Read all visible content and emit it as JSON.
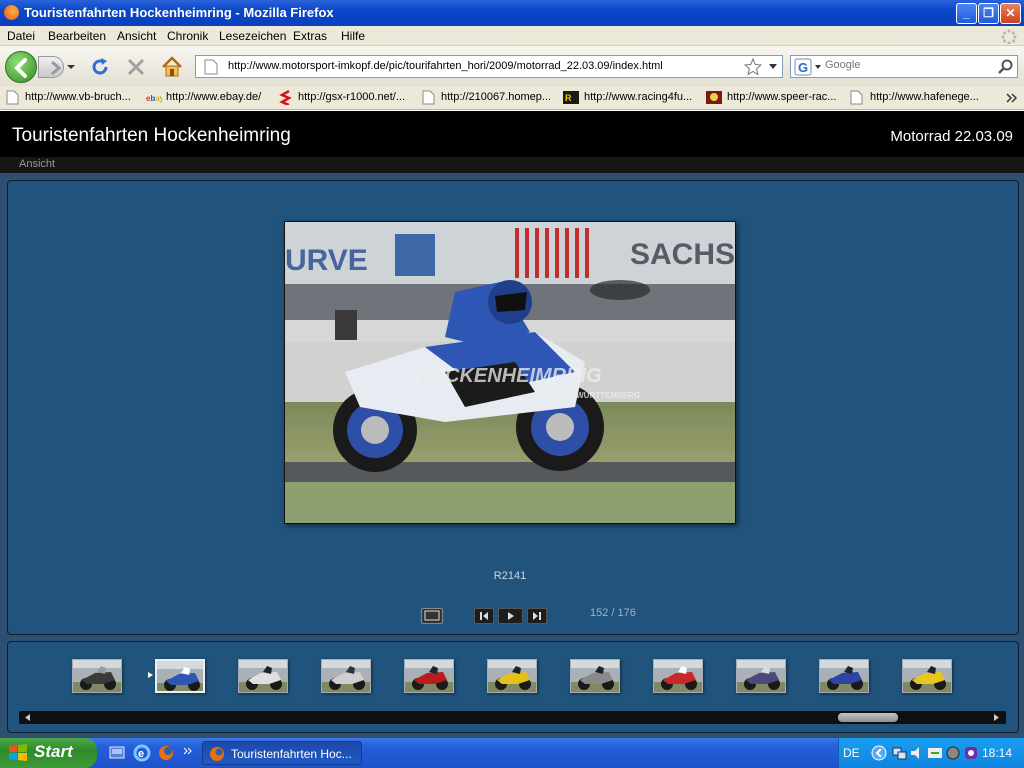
{
  "window": {
    "title": "Touristenfahrten Hockenheimring - Mozilla Firefox",
    "minimize_label": "_",
    "restore_label": "❐",
    "close_label": "✕"
  },
  "menubar": {
    "items": [
      "Datei",
      "Bearbeiten",
      "Ansicht",
      "Chronik",
      "Lesezeichen",
      "Extras",
      "Hilfe"
    ]
  },
  "navbar": {
    "url": "http://www.motorsport-imkopf.de/pic/tourifahrten_hori/2009/motorrad_22.03.09/index.html",
    "search_placeholder": "Google"
  },
  "bookmarks": [
    {
      "label": "http://www.vb-bruch...",
      "icon": "page-icon"
    },
    {
      "label": "http://www.ebay.de/",
      "icon": "ebay-icon"
    },
    {
      "label": "http://gsx-r1000.net/...",
      "icon": "suzuki-icon"
    },
    {
      "label": "http://210067.homep...",
      "icon": "page-icon"
    },
    {
      "label": "http://www.racing4fu...",
      "icon": "racing-icon"
    },
    {
      "label": "http://www.speer-rac...",
      "icon": "speer-icon"
    },
    {
      "label": "http://www.hafenege...",
      "icon": "page-icon"
    }
  ],
  "gallery": {
    "title": "Touristenfahrten Hockenheimring",
    "subtitle": "Motorrad 22.03.09",
    "view_menu": "Ansicht",
    "caption": "R2141",
    "counter": "152 / 176",
    "photo_watermark_main": "HOCKENHEIMRING",
    "photo_watermark_sub": "BADEN-WÜRTTEMBERG",
    "thumbnails": [
      {
        "bike": "#3a3a3a",
        "accent": "#9a9a9a"
      },
      {
        "bike": "#2d56b5",
        "accent": "#ffffff",
        "selected": true
      },
      {
        "bike": "#e0e0e0",
        "accent": "#222222"
      },
      {
        "bike": "#cfcfcf",
        "accent": "#333333"
      },
      {
        "bike": "#b81c1c",
        "accent": "#222222"
      },
      {
        "bike": "#e3c01a",
        "accent": "#222222"
      },
      {
        "bike": "#8a8a8a",
        "accent": "#222222"
      },
      {
        "bike": "#c92828",
        "accent": "#ffffff"
      },
      {
        "bike": "#4a4a7a",
        "accent": "#dddddd"
      },
      {
        "bike": "#2c44a8",
        "accent": "#222222"
      },
      {
        "bike": "#e8c51f",
        "accent": "#222222"
      }
    ]
  },
  "taskbar": {
    "start_label": "Start",
    "task_label": "Touristenfahrten Hoc...",
    "language": "DE",
    "clock": "18:14"
  },
  "colors": {
    "page_bg": "#2c4f72",
    "header_bg": "#000000",
    "viewer_bg": "#20547c"
  }
}
